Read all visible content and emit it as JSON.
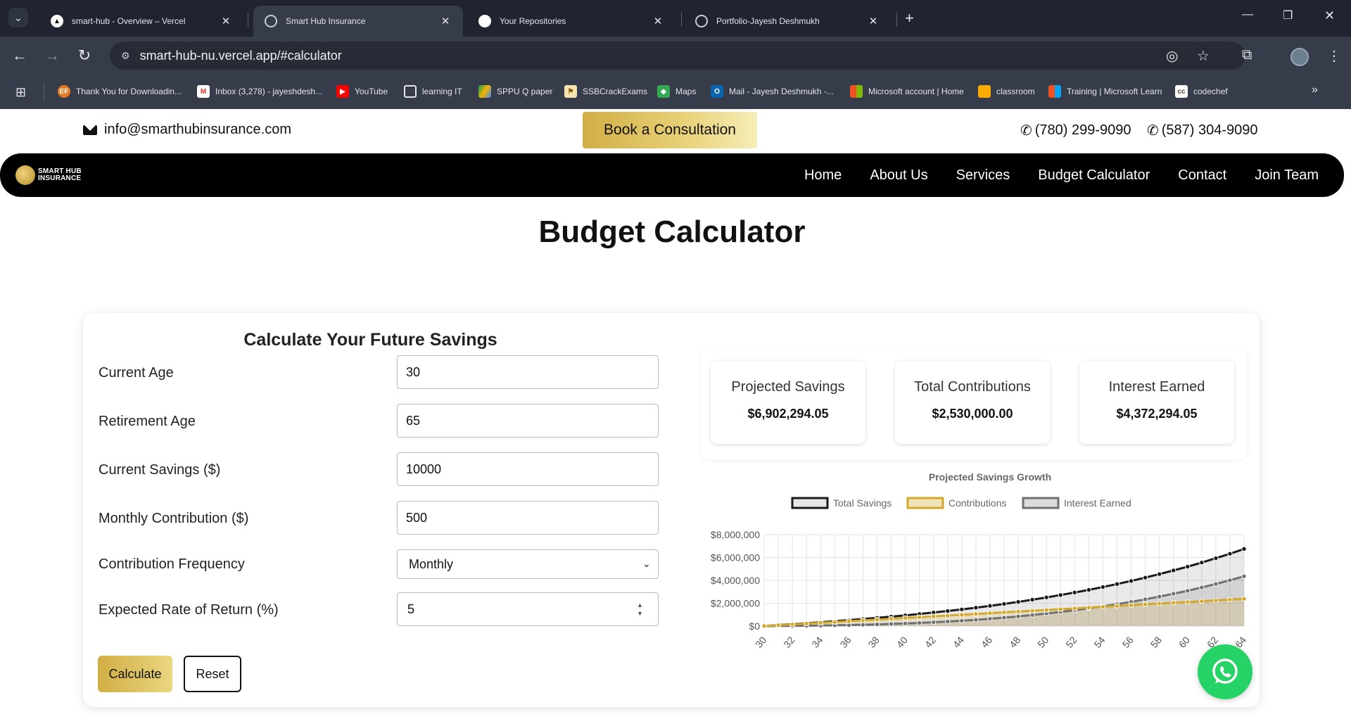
{
  "browser": {
    "tabs": [
      {
        "title": "smart-hub - Overview – Vercel",
        "icon": "vercel-icon"
      },
      {
        "title": "Smart Hub Insurance",
        "icon": "globe-icon"
      },
      {
        "title": "Your Repositories",
        "icon": "github-icon"
      },
      {
        "title": "Portfolio-Jayesh Deshmukh",
        "icon": "globe-icon"
      }
    ],
    "url": "smart-hub-nu.vercel.app/#calculator",
    "bookmarks": [
      {
        "label": "Thank You for Downloadin...",
        "icon": "ef-icon"
      },
      {
        "label": "Inbox (3,278) - jayeshdesh...",
        "icon": "gmail-icon"
      },
      {
        "label": "YouTube",
        "icon": "youtube-icon"
      },
      {
        "label": "learning IT",
        "icon": "folder-icon"
      },
      {
        "label": "SPPU Q paper",
        "icon": "drive-icon"
      },
      {
        "label": "SSBCrackExams",
        "icon": "ssb-icon"
      },
      {
        "label": "Maps",
        "icon": "maps-icon"
      },
      {
        "label": "Mail - Jayesh Deshmukh -...",
        "icon": "outlook-icon"
      },
      {
        "label": "Microsoft account | Home",
        "icon": "microsoft-icon"
      },
      {
        "label": "classroom",
        "icon": "classroom-icon"
      },
      {
        "label": "Training | Microsoft Learn",
        "icon": "microsoft-icon"
      },
      {
        "label": "codechef",
        "icon": "codechef-icon"
      }
    ]
  },
  "topbar": {
    "email": "info@smarthubinsurance.com",
    "book_label": "Book a Consultation",
    "phone1": "(780) 299-9090",
    "phone2": "(587) 304-9090"
  },
  "nav": {
    "logo_line1": "SMART HUB",
    "logo_line2": "INSURANCE",
    "links": [
      "Home",
      "About Us",
      "Services",
      "Budget Calculator",
      "Contact",
      "Join Team"
    ]
  },
  "page_title": "Budget Calculator",
  "form": {
    "title": "Calculate Your Future Savings",
    "fields": [
      {
        "label": "Current Age",
        "value": "30"
      },
      {
        "label": "Retirement Age",
        "value": "65"
      },
      {
        "label": "Current Savings ($)",
        "value": "10000"
      },
      {
        "label": "Monthly Contribution ($)",
        "value": "500"
      },
      {
        "label": "Contribution Frequency",
        "value": "Monthly"
      },
      {
        "label": "Expected Rate of Return (%)",
        "value": "5"
      }
    ],
    "calculate_label": "Calculate",
    "reset_label": "Reset"
  },
  "results": [
    {
      "label": "Projected Savings",
      "value": "$6,902,294.05"
    },
    {
      "label": "Total Contributions",
      "value": "$2,530,000.00"
    },
    {
      "label": "Interest Earned",
      "value": "$4,372,294.05"
    }
  ],
  "colors": {
    "gold": "#d2ae45",
    "total_line": "#1a1a1a",
    "contrib_line": "#d4a82a",
    "interest_line": "#707070"
  },
  "chart_data": {
    "type": "line",
    "title": "Projected Savings Growth",
    "xlabel": "",
    "ylabel": "",
    "ylim": [
      0,
      8000000
    ],
    "yticks": [
      "$0",
      "$2,000,000",
      "$4,000,000",
      "$6,000,000",
      "$8,000,000"
    ],
    "xticks": [
      "30",
      "32",
      "34",
      "36",
      "38",
      "40",
      "42",
      "44",
      "46",
      "48",
      "50",
      "52",
      "54",
      "56",
      "58",
      "60",
      "62",
      "64"
    ],
    "x": [
      30,
      31,
      32,
      33,
      34,
      35,
      36,
      37,
      38,
      39,
      40,
      41,
      42,
      43,
      44,
      45,
      46,
      47,
      48,
      49,
      50,
      51,
      52,
      53,
      54,
      55,
      56,
      57,
      58,
      59,
      60,
      61,
      62,
      63,
      64
    ],
    "legend_position": "top",
    "grid": true,
    "series": [
      {
        "name": "Total Savings",
        "values": [
          10000,
          90000,
          170000,
          250000,
          340000,
          430000,
          520000,
          620000,
          720000,
          830000,
          940000,
          1060000,
          1190000,
          1320000,
          1460000,
          1610000,
          1770000,
          1940000,
          2120000,
          2310000,
          2510000,
          2720000,
          2940000,
          3170000,
          3420000,
          3680000,
          3950000,
          4240000,
          4550000,
          4870000,
          5200000,
          5560000,
          5940000,
          6330000,
          6750000
        ]
      },
      {
        "name": "Contributions",
        "values": [
          10000,
          80000,
          150000,
          220000,
          290000,
          360000,
          430000,
          500000,
          570000,
          640000,
          710000,
          780000,
          850000,
          920000,
          990000,
          1060000,
          1130000,
          1200000,
          1270000,
          1340000,
          1410000,
          1480000,
          1550000,
          1620000,
          1690000,
          1760000,
          1830000,
          1900000,
          1970000,
          2040000,
          2110000,
          2180000,
          2250000,
          2320000,
          2390000
        ]
      },
      {
        "name": "Interest Earned",
        "values": [
          0,
          10000,
          20000,
          30000,
          50000,
          70000,
          90000,
          120000,
          150000,
          190000,
          230000,
          280000,
          340000,
          400000,
          470000,
          550000,
          640000,
          740000,
          850000,
          970000,
          1100000,
          1240000,
          1390000,
          1550000,
          1730000,
          1920000,
          2120000,
          2340000,
          2580000,
          2830000,
          3090000,
          3380000,
          3690000,
          4010000,
          4360000
        ]
      }
    ]
  }
}
